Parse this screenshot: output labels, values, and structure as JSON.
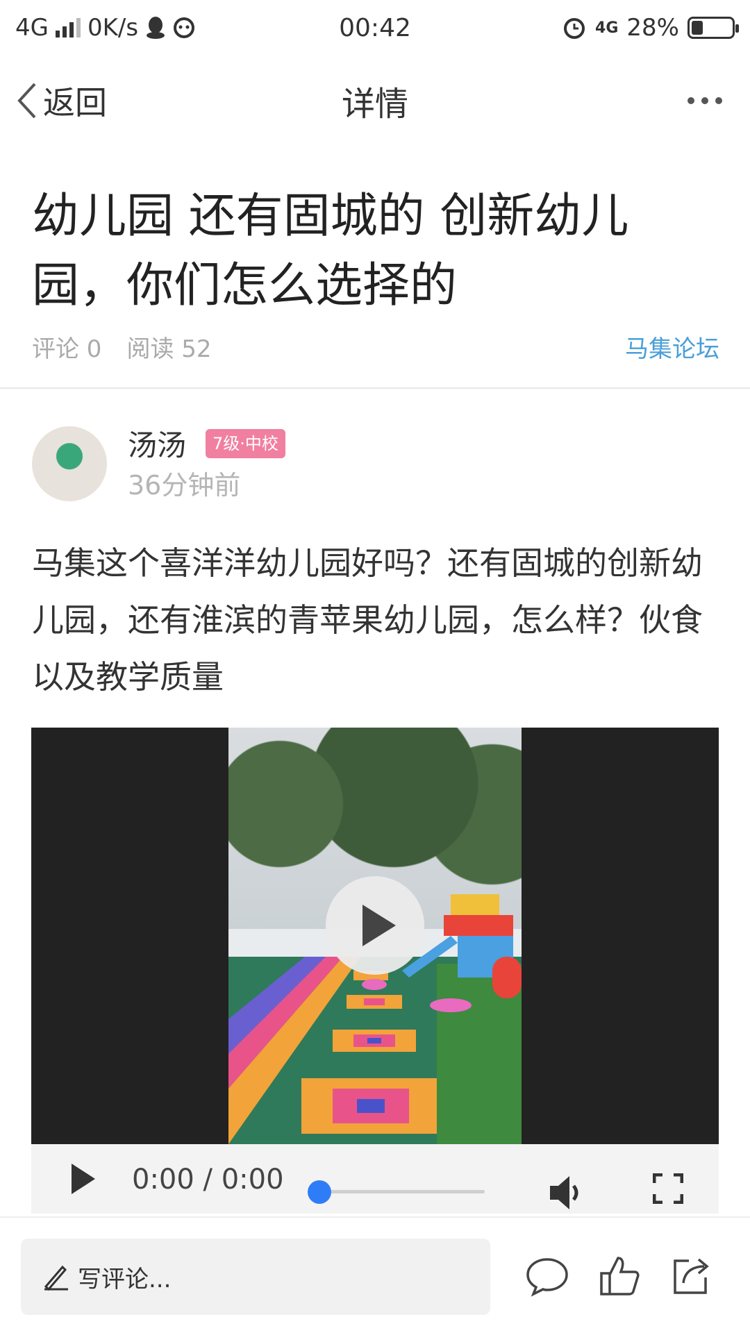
{
  "status_bar": {
    "network": "4G",
    "speed": "0K/s",
    "time": "00:42",
    "network_right": "4G",
    "battery": "28%"
  },
  "nav": {
    "back_label": "返回",
    "title": "详情"
  },
  "post": {
    "title": "幼儿园 还有固城的 创新幼儿园，你们怎么选择的",
    "comments_label": "评论 0",
    "reads_label": "阅读 52",
    "forum": "马集论坛",
    "author": {
      "name": "汤汤",
      "badge": "7级·中校",
      "time": "36分钟前"
    },
    "body": "马集这个喜洋洋幼儿园好吗？还有固城的创新幼儿园，还有淮滨的青苹果幼儿园，怎么样？伙食 以及教学质量"
  },
  "video": {
    "time_display": "0:00 / 0:00",
    "progress": 0
  },
  "bottom_bar": {
    "comment_placeholder": "写评论..."
  },
  "colors": {
    "accent_blue": "#4a9fd8",
    "badge_pink": "#f07fa0",
    "progress_blue": "#2f7df6"
  },
  "icons": [
    "back-chevron-icon",
    "more-dots-icon",
    "play-icon",
    "volume-icon",
    "fullscreen-icon",
    "pencil-icon",
    "comment-bubble-icon",
    "thumbs-up-icon",
    "share-icon",
    "alarm-icon",
    "qq-icon",
    "chat-icon"
  ]
}
